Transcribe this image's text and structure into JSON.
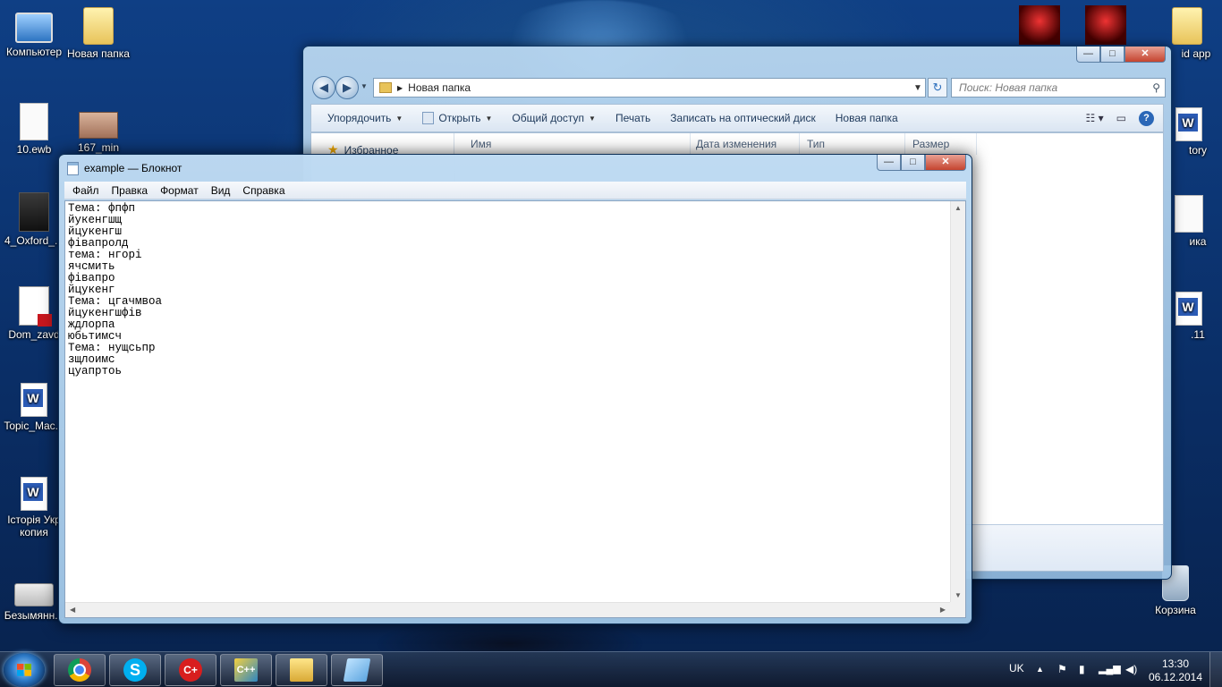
{
  "desktop": {
    "icons_left": [
      {
        "label": "Компьютер",
        "icon": "computer-icon"
      },
      {
        "label": "Новая папка",
        "icon": "folder-icon"
      },
      {
        "label": "10.ewb",
        "icon": "file-icon"
      },
      {
        "label": "167_min",
        "icon": "image-icon"
      },
      {
        "label": "4_Oxford_...",
        "icon": "pdf-icon"
      },
      {
        "label": "Dom_zavd",
        "icon": "pdf-icon"
      },
      {
        "label": "Topic_Mac...",
        "icon": "word-icon"
      },
      {
        "label": "Історія Укр копия",
        "icon": "word-icon"
      },
      {
        "label": "Безымянн...",
        "icon": "scanner-icon"
      }
    ],
    "icons_right": [
      {
        "label": "id app",
        "icon": "folder-icon"
      },
      {
        "label": "tory",
        "icon": "word-icon"
      },
      {
        "label": "ика",
        "icon": "doc-icon"
      },
      {
        "label": ".11",
        "icon": "word-icon"
      },
      {
        "label": "Корзина",
        "icon": "recycle-bin-icon"
      }
    ]
  },
  "explorer": {
    "address": "Новая папка",
    "search_placeholder": "Поиск: Новая папка",
    "toolbar": {
      "organize": "Упорядочить",
      "open": "Открыть",
      "share": "Общий доступ",
      "print": "Печать",
      "burn": "Записать на оптический диск",
      "new_folder": "Новая папка"
    },
    "nav_favorites": "Избранное",
    "columns": [
      "Имя",
      "Дата изменения",
      "Тип",
      "Размер"
    ]
  },
  "notepad": {
    "title": "example — Блокнот",
    "menu": [
      "Файл",
      "Правка",
      "Формат",
      "Вид",
      "Справка"
    ],
    "lines": [
      "Тема: фпфп",
      "йукенгшщ",
      "йцукенгш",
      "фівапролд",
      "тема: нгорі",
      "ячсмить",
      "фівапро",
      "йцукенг",
      "Тема: цгачмвоа",
      "йцукенгшфів",
      "ждлорпа",
      "юбьтимсч",
      "Тема: нущсьпр",
      "зщлоимс",
      "цуапртоь"
    ]
  },
  "taskbar": {
    "apps": [
      "chrome-icon",
      "skype-icon",
      "cpp-icon",
      "codeblocks-icon",
      "explorer-icon",
      "notepad-icon"
    ],
    "language": "UK",
    "time": "13:30",
    "date": "06.12.2014"
  },
  "colors": {
    "desktop_bg": "#0f3f85",
    "accent": "#2b67b7"
  }
}
